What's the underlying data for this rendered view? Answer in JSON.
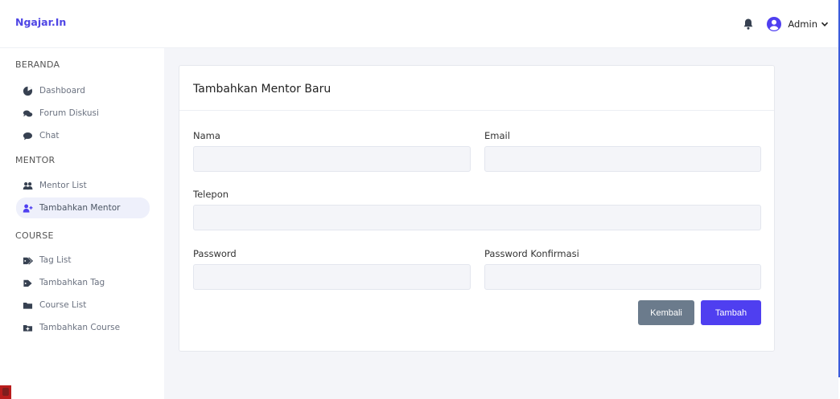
{
  "brand": "Ngajar.In",
  "topbar": {
    "user_label": "Admin"
  },
  "sidebar": {
    "sections": [
      {
        "title": "BERANDA",
        "items": [
          {
            "label": "Dashboard"
          },
          {
            "label": "Forum Diskusi"
          },
          {
            "label": "Chat"
          }
        ]
      },
      {
        "title": "MENTOR",
        "items": [
          {
            "label": "Mentor List"
          },
          {
            "label": "Tambahkan Mentor"
          }
        ]
      },
      {
        "title": "COURSE",
        "items": [
          {
            "label": "Tag List"
          },
          {
            "label": "Tambahkan Tag"
          },
          {
            "label": "Course List"
          },
          {
            "label": "Tambahkan Course"
          }
        ]
      }
    ],
    "active_item": "Tambahkan Mentor"
  },
  "form": {
    "title": "Tambahkan Mentor Baru",
    "fields": {
      "nama": {
        "label": "Nama",
        "value": ""
      },
      "email": {
        "label": "Email",
        "value": ""
      },
      "telepon": {
        "label": "Telepon",
        "value": ""
      },
      "password": {
        "label": "Password",
        "value": ""
      },
      "password_konfirmasi": {
        "label": "Password Konfirmasi",
        "value": ""
      }
    },
    "buttons": {
      "back": "Kembali",
      "submit": "Tambah"
    }
  },
  "colors": {
    "accent": "#4f3ff0",
    "secondary": "#6b7b8c",
    "brand": "#4f46e5",
    "background": "#f4f5f9"
  }
}
